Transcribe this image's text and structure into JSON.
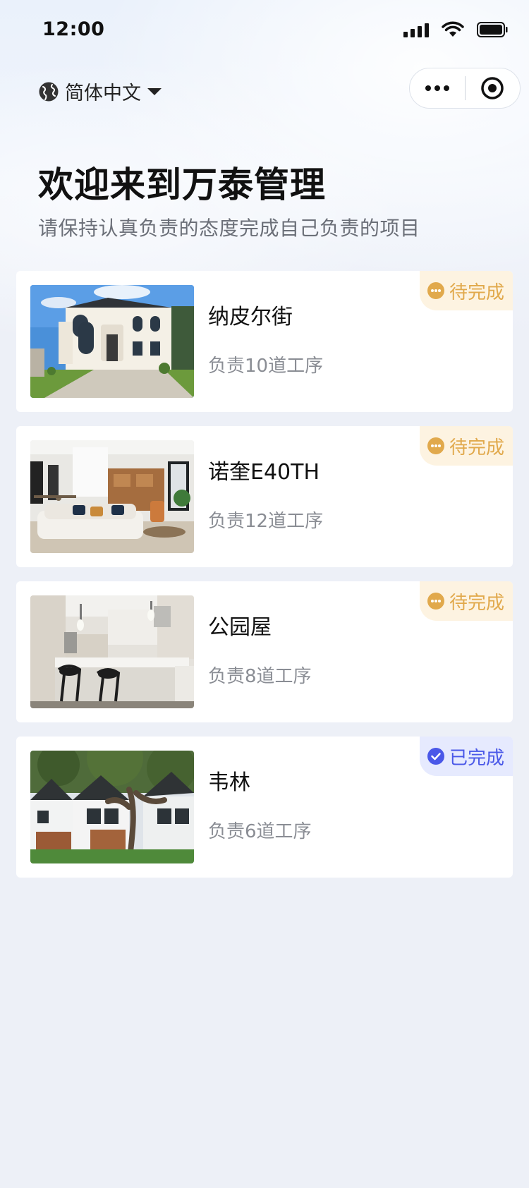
{
  "status_bar": {
    "time": "12:00"
  },
  "language": {
    "label": "简体中文",
    "icon": "globe-icon"
  },
  "header": {
    "title": "欢迎来到万泰管理",
    "subtitle": "请保持认真负责的态度完成自己负责的项目"
  },
  "projects": [
    {
      "name": "纳皮尔街",
      "tasks": "负责10道工序",
      "status": "待完成",
      "status_type": "pending",
      "image": "white-villa-exterior"
    },
    {
      "name": "诺奎E40TH",
      "tasks": "负责12道工序",
      "status": "待完成",
      "status_type": "pending",
      "image": "living-room-interior"
    },
    {
      "name": "公园屋",
      "tasks": "负责8道工序",
      "status": "待完成",
      "status_type": "pending",
      "image": "kitchen-interior"
    },
    {
      "name": "韦林",
      "tasks": "负责6道工序",
      "status": "已完成",
      "status_type": "done",
      "image": "townhouse-with-tree"
    }
  ],
  "colors": {
    "pending_text": "#e1a94c",
    "pending_bg": "#fdf3e1",
    "done_text": "#4a58e8",
    "done_bg": "#e6eafe",
    "page_bg": "#edf0f7"
  }
}
